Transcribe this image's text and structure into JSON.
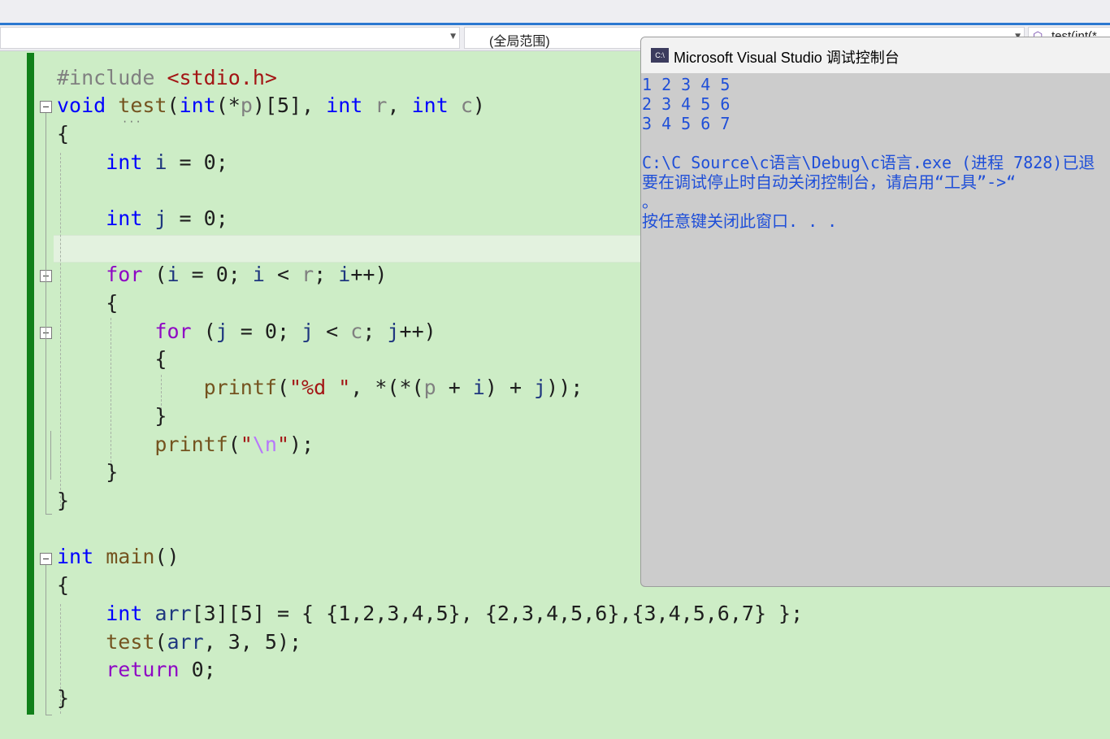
{
  "navbar": {
    "scope": "(全局范围)",
    "function": "test(int(*",
    "scope_icon": "cube-icon"
  },
  "code_lines": [
    "#include <stdio.h>",
    "void test(int(*p)[5], int r, int c)",
    "{",
    "int i = 0;",
    "int j = 0;",
    "for (i = 0; i < r; i++)",
    "{",
    "for (j = 0; j < c; j++)",
    "{",
    "printf(\"%d \", *(*(p + i) + j));",
    "}",
    "printf(\"\\n\");",
    "}",
    "}",
    "int main()",
    "{",
    "int arr[3][5] = { {1,2,3,4,5}, {2,3,4,5,6},{3,4,5,6,7} };",
    "test(arr, 3, 5);",
    "return 0;",
    "}"
  ],
  "console": {
    "icon_label": "C:\\",
    "title": "Microsoft Visual Studio 调试控制台",
    "lines": [
      "1 2 3 4 5",
      "2 3 4 5 6",
      "3 4 5 6 7",
      "",
      "C:\\C Source\\c语言\\Debug\\c语言.exe (进程 7828)已退",
      "要在调试停止时自动关闭控制台，请启用“工具”->“",
      "。",
      "按任意键关闭此窗口. . ."
    ]
  },
  "colors": {
    "editor_background": "#cdedc6",
    "keyword": "#0000ff",
    "control_keyword": "#8f08c4",
    "function": "#74531f",
    "string": "#a31515",
    "console_text": "#1f4fd8",
    "change_bar": "#11801a"
  }
}
